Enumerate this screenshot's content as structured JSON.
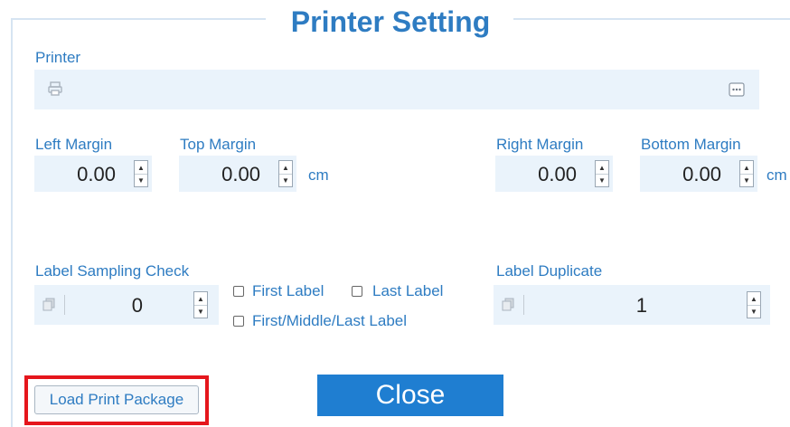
{
  "dialog": {
    "title": "Printer Setting"
  },
  "printer": {
    "label": "Printer",
    "value": ""
  },
  "margins": {
    "left": {
      "label": "Left Margin",
      "value": "0.00"
    },
    "top": {
      "label": "Top Margin",
      "value": "0.00"
    },
    "right": {
      "label": "Right Margin",
      "value": "0.00"
    },
    "bottom": {
      "label": "Bottom Margin",
      "value": "0.00"
    },
    "unit": "cm"
  },
  "label_sampling": {
    "label": "Label Sampling Check",
    "value": "0",
    "options": {
      "first": "First Label",
      "last": "Last Label",
      "first_middle_last": "First/Middle/Last Label"
    }
  },
  "label_duplicate": {
    "label": "Label Duplicate",
    "value": "1"
  },
  "buttons": {
    "load_print_package": "Load Print Package",
    "close": "Close"
  },
  "colors": {
    "accent": "#2e7cc2",
    "field_bg": "#eaf3fb",
    "close_bg": "#1f7ed1",
    "highlight": "#e5161c"
  },
  "icons": [
    "printer-icon",
    "ellipsis-icon",
    "spin-up-icon",
    "spin-down-icon",
    "copy-icon"
  ]
}
